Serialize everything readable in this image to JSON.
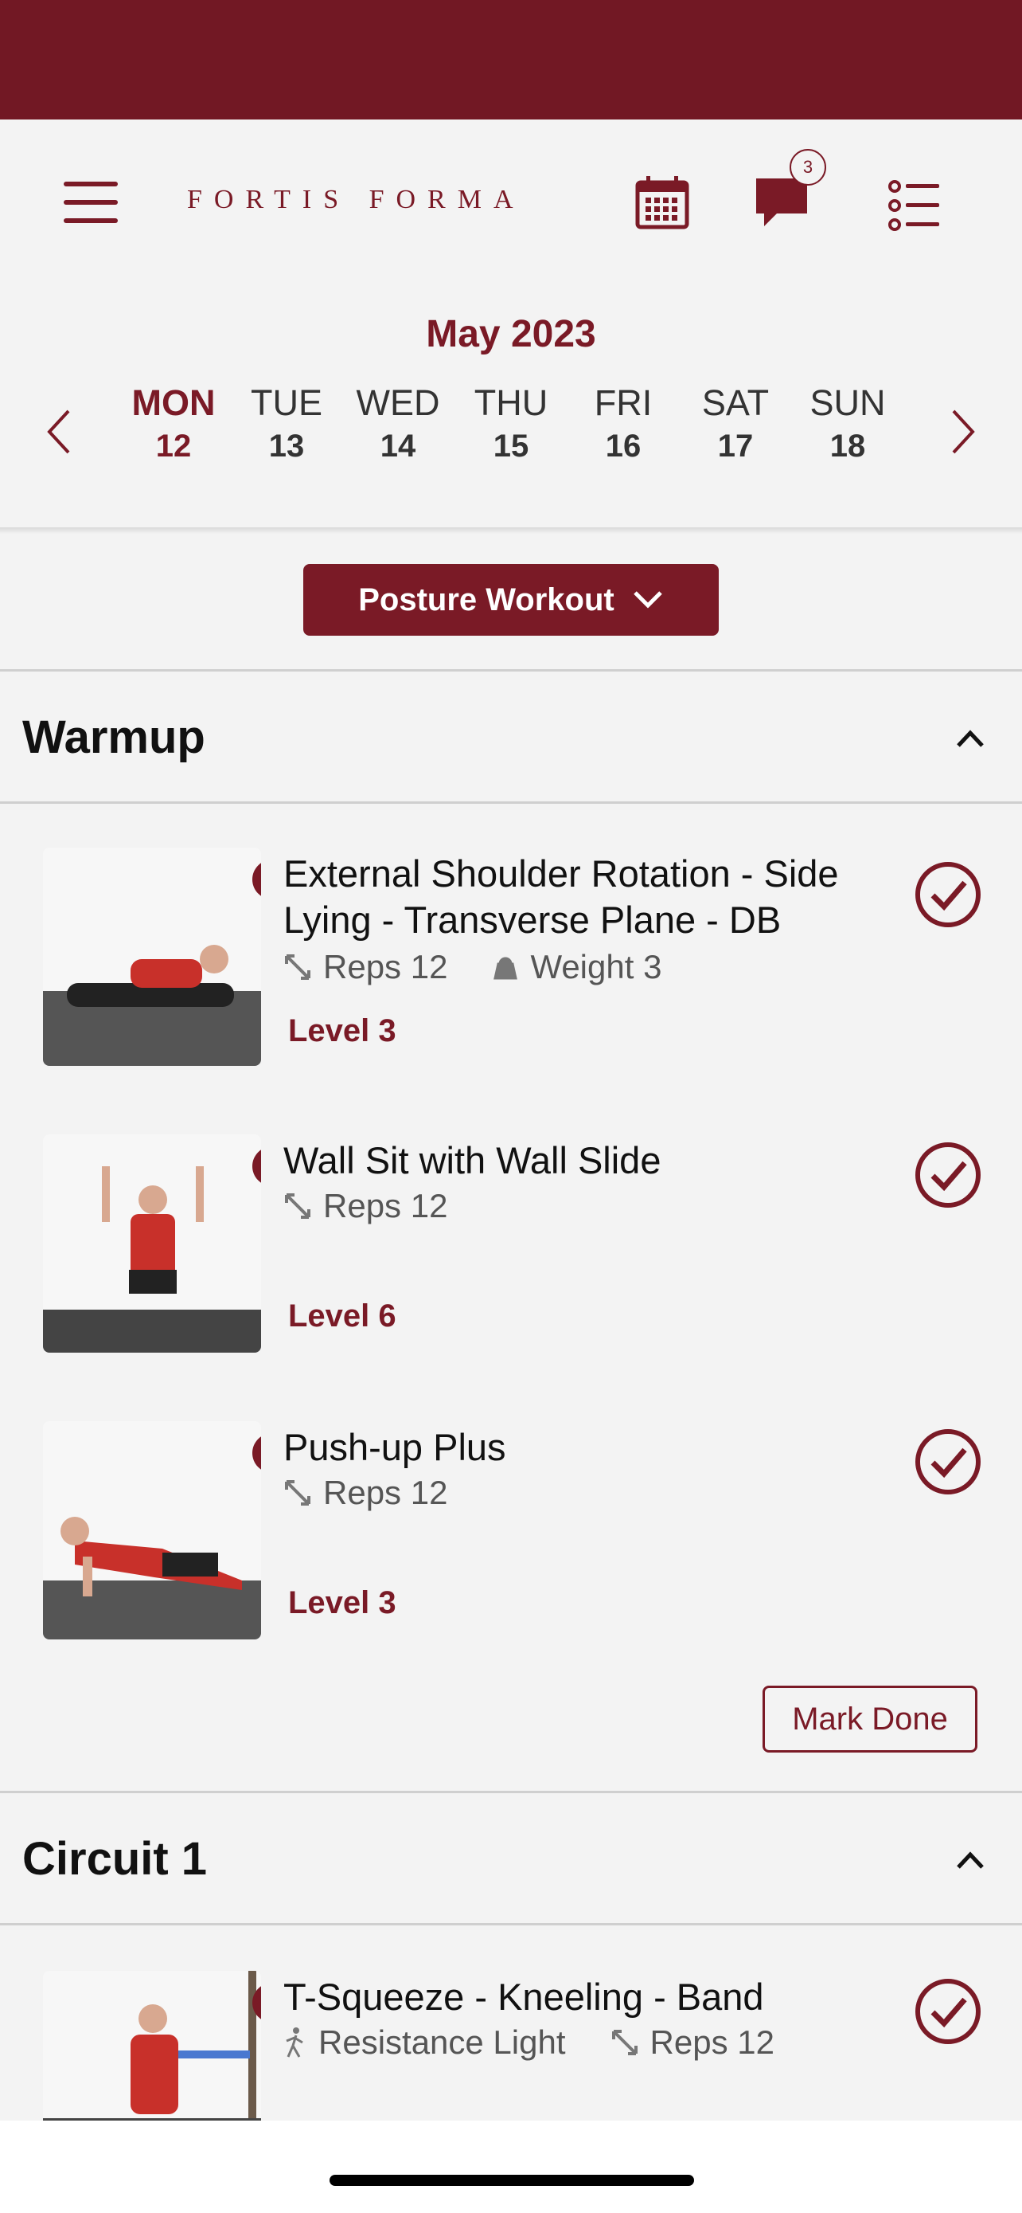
{
  "app": {
    "brand": "FORTIS FORMA",
    "messages_badge": "3",
    "brand_color": "#7a1a26",
    "status_bar_color": "#721824"
  },
  "header": {
    "menu_icon": "hamburger-menu-icon",
    "calendar_icon": "calendar-icon",
    "messages_icon": "chat-bubble-icon",
    "list_icon": "checklist-icon"
  },
  "calendar": {
    "month": "May 2023",
    "days": [
      {
        "name": "MON",
        "date": "12"
      },
      {
        "name": "TUE",
        "date": "13"
      },
      {
        "name": "WED",
        "date": "14"
      },
      {
        "name": "THU",
        "date": "15"
      },
      {
        "name": "FRI",
        "date": "16"
      },
      {
        "name": "SAT",
        "date": "17"
      },
      {
        "name": "SUN",
        "date": "18"
      }
    ],
    "selected_index": 0
  },
  "workout_select": {
    "value": "Posture Workout"
  },
  "sections": [
    {
      "title": "Warmup",
      "exercises": [
        {
          "name": "External Shoulder Rotation - Side Lying - Transverse Plane - DB",
          "reps": "Reps 12",
          "weight": "Weight 3",
          "level": "Level 3"
        },
        {
          "name": "Wall Sit with Wall Slide",
          "reps": "Reps 12",
          "level": "Level 6"
        },
        {
          "name": "Push-up Plus",
          "reps": "Reps 12",
          "level": "Level 3"
        }
      ],
      "mark_done": "Mark Done"
    },
    {
      "title": "Circuit 1",
      "exercises": [
        {
          "name": "T-Squeeze - Kneeling - Band",
          "resistance": "Resistance Light",
          "reps": "Reps 12"
        }
      ]
    }
  ]
}
